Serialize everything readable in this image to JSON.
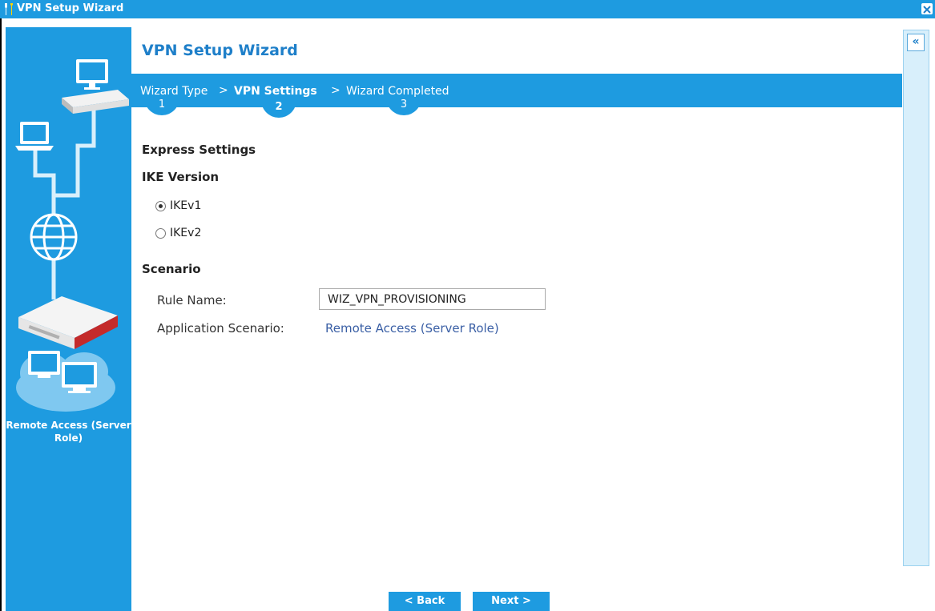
{
  "window": {
    "title": "VPN Setup Wizard",
    "close_icon": "close-icon",
    "app_icon": "wizard-tools-icon"
  },
  "illustration": {
    "caption": "Remote Access (Server Role)",
    "icons": [
      "monitor-icon",
      "switch-icon",
      "laptop-icon",
      "globe-icon",
      "router-icon",
      "computers-icon"
    ]
  },
  "help_panel": {
    "collapse_icon": "double-chevron-left-icon",
    "collapse_label": "«"
  },
  "wizard": {
    "heading": "VPN Setup Wizard",
    "steps": [
      {
        "label": "Wizard Type",
        "number": "1",
        "active": false
      },
      {
        "label": "VPN Settings",
        "number": "2",
        "active": true
      },
      {
        "label": "Wizard Completed",
        "number": "3",
        "active": false
      }
    ],
    "step_separator": ">"
  },
  "express_settings": {
    "heading": "Express Settings",
    "ike_version": {
      "heading": "IKE Version",
      "options": [
        {
          "label": "IKEv1",
          "selected": true
        },
        {
          "label": "IKEv2",
          "selected": false
        }
      ]
    },
    "scenario": {
      "heading": "Scenario",
      "rule_name_label": "Rule Name:",
      "rule_name_value": "WIZ_VPN_PROVISIONING",
      "application_scenario_label": "Application Scenario:",
      "application_scenario_value": "Remote Access (Server Role)"
    }
  },
  "footer": {
    "back_label": "< Back",
    "next_label": "Next >"
  },
  "colors": {
    "accent": "#1e9be0",
    "heading_blue": "#1e7fc9",
    "link_blue": "#3a5fa5"
  }
}
